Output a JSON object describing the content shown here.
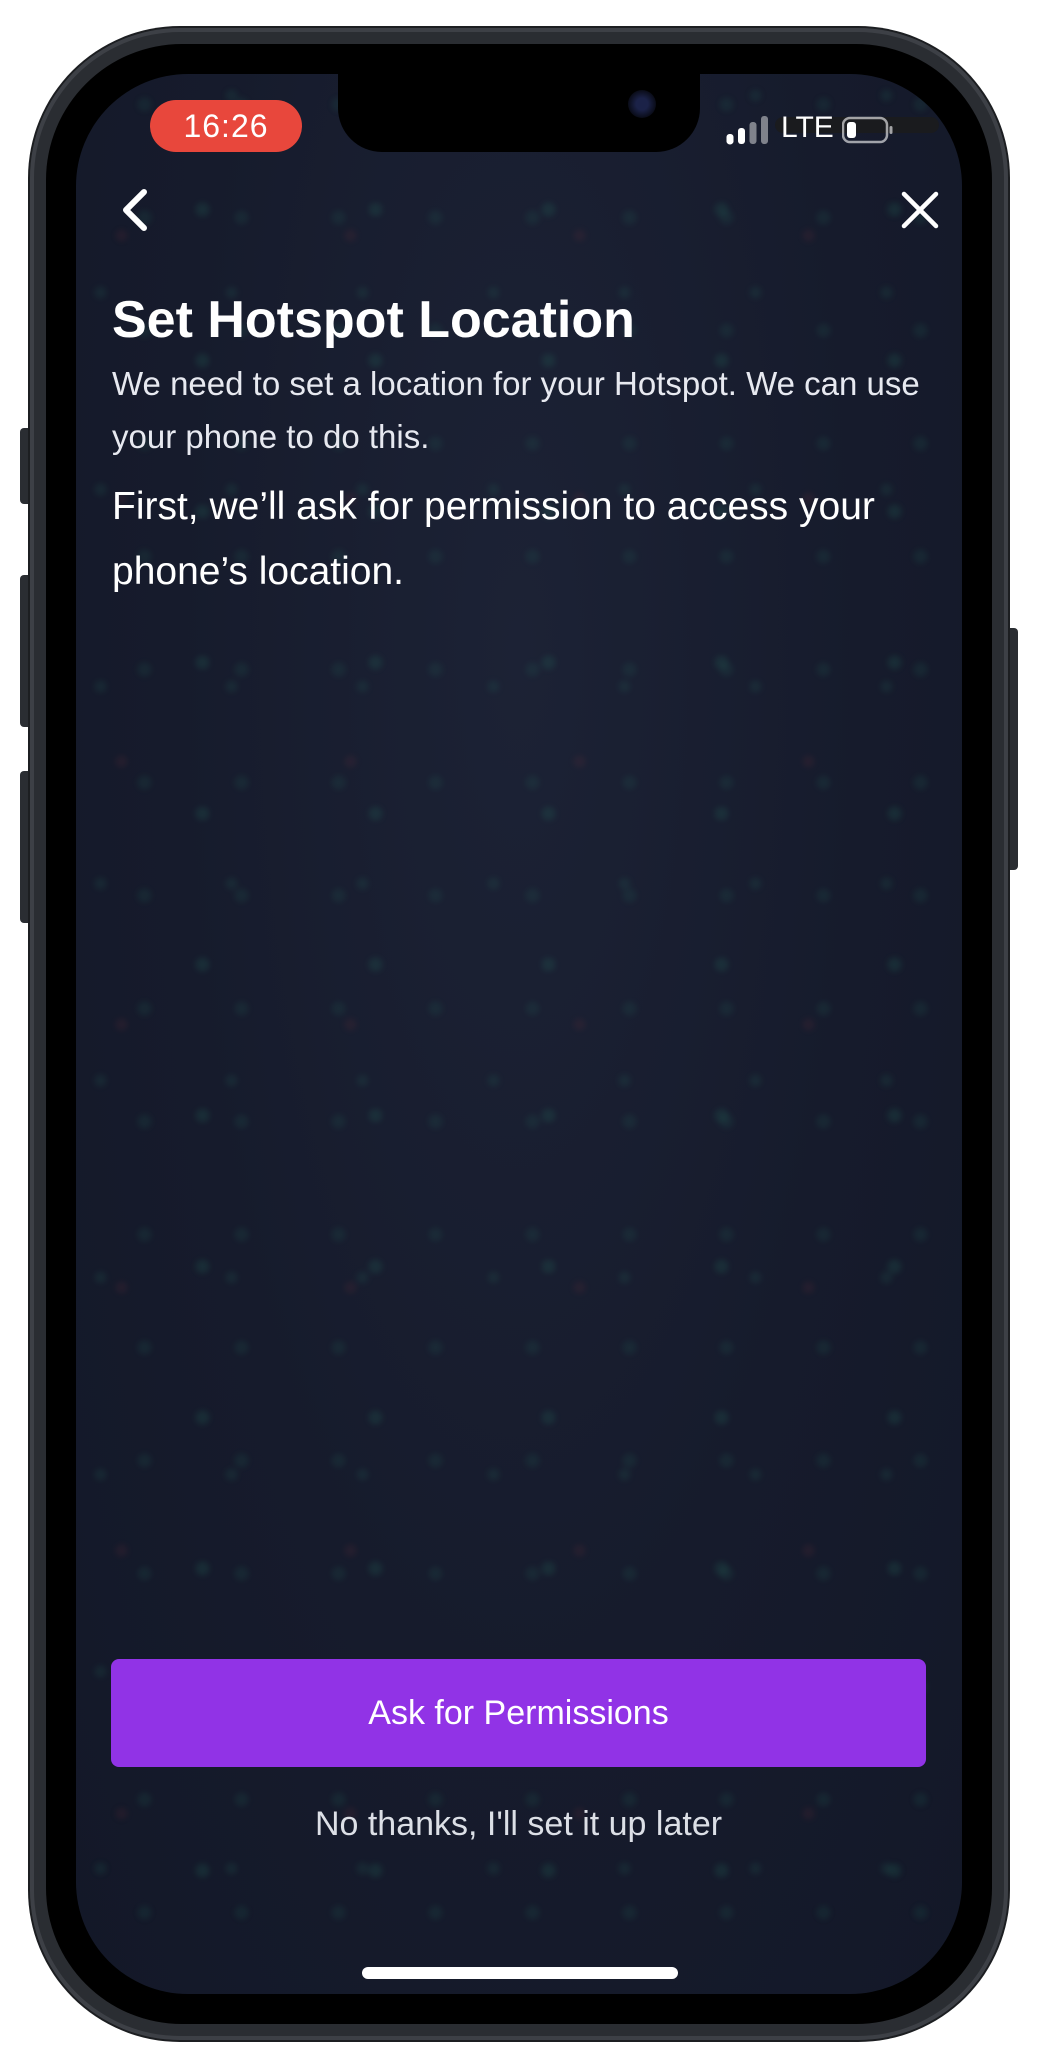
{
  "status_bar": {
    "time": "16:26",
    "network": "LTE",
    "icons": [
      "cellular-signal-icon",
      "battery-icon"
    ]
  },
  "nav": {
    "back_icon": "chevron-left-icon",
    "close_icon": "close-icon"
  },
  "content": {
    "title": "Set Hotspot Location",
    "subtitle": "We need to set a location for your Hotspot. We can use your phone to do this.",
    "lead": "First, we’ll ask for permission to access your phone’s location."
  },
  "actions": {
    "primary_label": "Ask for Permissions",
    "secondary_label": "No thanks, I'll set it up later"
  },
  "colors": {
    "background": "#161b2c",
    "primary_button": "#9133e6",
    "time_pill": "#e8473c",
    "text": "#ffffff"
  }
}
